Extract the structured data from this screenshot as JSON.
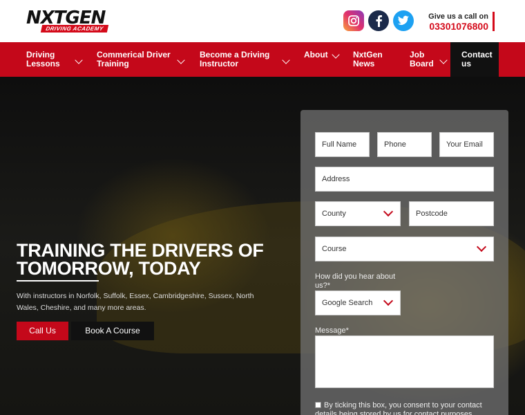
{
  "header": {
    "logo_main": "NXTGEN",
    "logo_sub": "DRIVING ACADEMY",
    "social": [
      "instagram-icon",
      "facebook-icon",
      "twitter-icon"
    ],
    "call_label": "Give us a call on",
    "call_number": "03301076800"
  },
  "nav": {
    "items": [
      {
        "label": "Driving\nLessons"
      },
      {
        "label": "Commerical Driver\nTraining"
      },
      {
        "label": "Become a Driving\nInstructor"
      },
      {
        "label": "About"
      },
      {
        "label": "NxtGen\nNews"
      },
      {
        "label": "Job\nBoard"
      }
    ],
    "contact": "Contact\nus"
  },
  "hero": {
    "title": "TRAINING THE DRIVERS OF\nTOMORROW, TODAY",
    "subtitle": "With instructors in Norfolk, Suffolk, Essex, Cambridgeshire, Sussex, North Wales, Cheshire, and many more areas.",
    "call_btn": "Call Us",
    "book_btn": "Book A Course"
  },
  "form": {
    "full_name": "Full Name",
    "phone": "Phone",
    "email": "Your Email",
    "address": "Address",
    "county": "County",
    "postcode": "Postcode",
    "course": "Course",
    "heard_label": "How did you hear about us?*",
    "heard_value": "Google Search",
    "message_label": "Message*",
    "consent": "By ticking this box, you consent to your contact details being stored by us for contact purposes."
  },
  "colors": {
    "brand_red": "#c4081a",
    "dark": "#111111"
  }
}
